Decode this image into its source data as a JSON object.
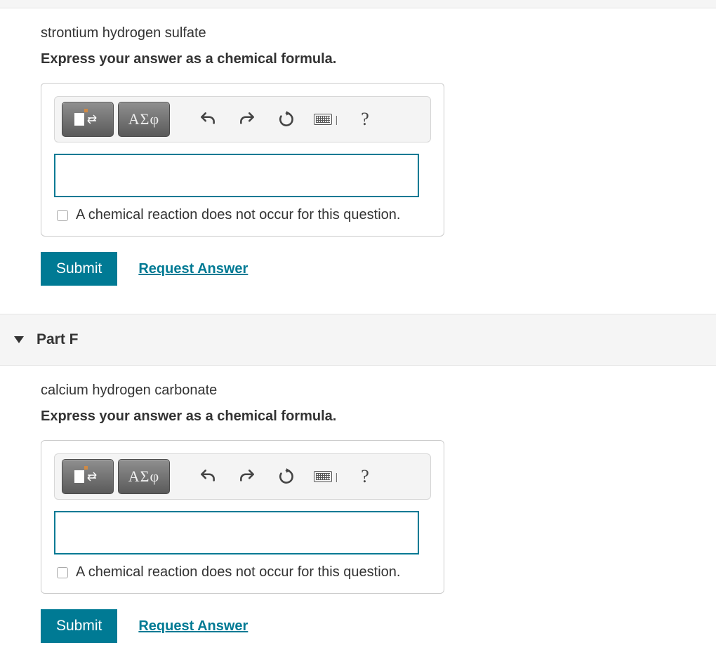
{
  "partE": {
    "question": "strontium hydrogen sulfate",
    "instruction": "Express your answer as a chemical formula.",
    "toolbar": {
      "greek_label": "ΑΣφ",
      "help": "?"
    },
    "checkbox_label": "A chemical reaction does not occur for this question.",
    "submit_label": "Submit",
    "request_label": "Request Answer"
  },
  "partF": {
    "title": "Part F",
    "question": "calcium hydrogen carbonate",
    "instruction": "Express your answer as a chemical formula.",
    "toolbar": {
      "greek_label": "ΑΣφ",
      "help": "?"
    },
    "checkbox_label": "A chemical reaction does not occur for this question.",
    "submit_label": "Submit",
    "request_label": "Request Answer"
  }
}
